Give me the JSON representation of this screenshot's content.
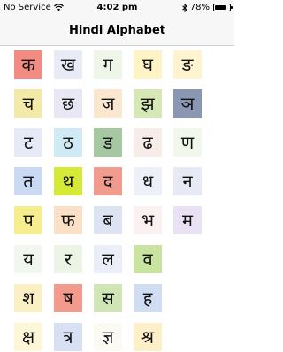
{
  "status_bar": {
    "carrier": "No Service",
    "time": "4:02 pm",
    "battery": "78%",
    "battery_level": 0.78
  },
  "nav": {
    "title": "Hindi Alphabet"
  },
  "letters": [
    {
      "char": "क",
      "color": "#f28b82"
    },
    {
      "char": "ख",
      "color": "#e8eaf6"
    },
    {
      "char": "ग",
      "color": "#eef5e9"
    },
    {
      "char": "घ",
      "color": "#fdf3c4"
    },
    {
      "char": "ङ",
      "color": "#fff3d0"
    },
    {
      "char": "च",
      "color": "#f3e9a8"
    },
    {
      "char": "छ",
      "color": "#e8e8f4"
    },
    {
      "char": "ज",
      "color": "#fbe7cf"
    },
    {
      "char": "झ",
      "color": "#d6e8b5"
    },
    {
      "char": "ञ",
      "color": "#8a97b3"
    },
    {
      "char": "ट",
      "color": "#e6e9f6"
    },
    {
      "char": "ठ",
      "color": "#cfe9f5"
    },
    {
      "char": "ड",
      "color": "#a5c7a1"
    },
    {
      "char": "ढ",
      "color": "#f7ece7"
    },
    {
      "char": "ण",
      "color": "#f1f7ea"
    },
    {
      "char": "त",
      "color": "#c9daf2"
    },
    {
      "char": "थ",
      "color": "#d4ea36"
    },
    {
      "char": "द",
      "color": "#f19b8e"
    },
    {
      "char": "ध",
      "color": "#eef0f9"
    },
    {
      "char": "न",
      "color": "#e7e9f4"
    },
    {
      "char": "प",
      "color": "#f6ee8c"
    },
    {
      "char": "फ",
      "color": "#fbe0c8"
    },
    {
      "char": "ब",
      "color": "#dde3f3"
    },
    {
      "char": "भ",
      "color": "#fbf1f1"
    },
    {
      "char": "म",
      "color": "#e9e1f4"
    },
    {
      "char": "य",
      "color": "#f1f7ee"
    },
    {
      "char": "र",
      "color": "#ecf4e5"
    },
    {
      "char": "ल",
      "color": "#eceef7"
    },
    {
      "char": "व",
      "color": "#c9e3a0"
    },
    {
      "char": "श",
      "color": "#fbf0c4"
    },
    {
      "char": "ष",
      "color": "#f39a8c"
    },
    {
      "char": "स",
      "color": "#cfe5b5"
    },
    {
      "char": "ह",
      "color": "#d0dcf2"
    },
    {
      "char": "क्ष",
      "color": "#fdf7d7"
    },
    {
      "char": "त्र",
      "color": "#d7e1f3"
    },
    {
      "char": "ज्ञ",
      "color": "#fbfaf3"
    },
    {
      "char": "श्र",
      "color": "#fdf0c8"
    }
  ]
}
